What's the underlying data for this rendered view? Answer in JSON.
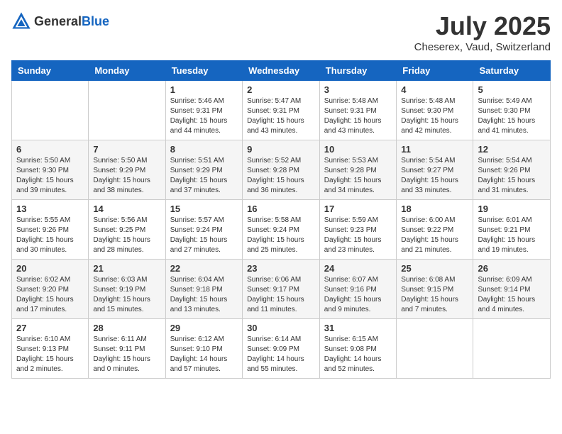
{
  "header": {
    "logo_general": "General",
    "logo_blue": "Blue",
    "month_title": "July 2025",
    "subtitle": "Cheserex, Vaud, Switzerland"
  },
  "days_of_week": [
    "Sunday",
    "Monday",
    "Tuesday",
    "Wednesday",
    "Thursday",
    "Friday",
    "Saturday"
  ],
  "weeks": [
    [
      {
        "day": "",
        "info": ""
      },
      {
        "day": "",
        "info": ""
      },
      {
        "day": "1",
        "info": "Sunrise: 5:46 AM\nSunset: 9:31 PM\nDaylight: 15 hours and 44 minutes."
      },
      {
        "day": "2",
        "info": "Sunrise: 5:47 AM\nSunset: 9:31 PM\nDaylight: 15 hours and 43 minutes."
      },
      {
        "day": "3",
        "info": "Sunrise: 5:48 AM\nSunset: 9:31 PM\nDaylight: 15 hours and 43 minutes."
      },
      {
        "day": "4",
        "info": "Sunrise: 5:48 AM\nSunset: 9:30 PM\nDaylight: 15 hours and 42 minutes."
      },
      {
        "day": "5",
        "info": "Sunrise: 5:49 AM\nSunset: 9:30 PM\nDaylight: 15 hours and 41 minutes."
      }
    ],
    [
      {
        "day": "6",
        "info": "Sunrise: 5:50 AM\nSunset: 9:30 PM\nDaylight: 15 hours and 39 minutes."
      },
      {
        "day": "7",
        "info": "Sunrise: 5:50 AM\nSunset: 9:29 PM\nDaylight: 15 hours and 38 minutes."
      },
      {
        "day": "8",
        "info": "Sunrise: 5:51 AM\nSunset: 9:29 PM\nDaylight: 15 hours and 37 minutes."
      },
      {
        "day": "9",
        "info": "Sunrise: 5:52 AM\nSunset: 9:28 PM\nDaylight: 15 hours and 36 minutes."
      },
      {
        "day": "10",
        "info": "Sunrise: 5:53 AM\nSunset: 9:28 PM\nDaylight: 15 hours and 34 minutes."
      },
      {
        "day": "11",
        "info": "Sunrise: 5:54 AM\nSunset: 9:27 PM\nDaylight: 15 hours and 33 minutes."
      },
      {
        "day": "12",
        "info": "Sunrise: 5:54 AM\nSunset: 9:26 PM\nDaylight: 15 hours and 31 minutes."
      }
    ],
    [
      {
        "day": "13",
        "info": "Sunrise: 5:55 AM\nSunset: 9:26 PM\nDaylight: 15 hours and 30 minutes."
      },
      {
        "day": "14",
        "info": "Sunrise: 5:56 AM\nSunset: 9:25 PM\nDaylight: 15 hours and 28 minutes."
      },
      {
        "day": "15",
        "info": "Sunrise: 5:57 AM\nSunset: 9:24 PM\nDaylight: 15 hours and 27 minutes."
      },
      {
        "day": "16",
        "info": "Sunrise: 5:58 AM\nSunset: 9:24 PM\nDaylight: 15 hours and 25 minutes."
      },
      {
        "day": "17",
        "info": "Sunrise: 5:59 AM\nSunset: 9:23 PM\nDaylight: 15 hours and 23 minutes."
      },
      {
        "day": "18",
        "info": "Sunrise: 6:00 AM\nSunset: 9:22 PM\nDaylight: 15 hours and 21 minutes."
      },
      {
        "day": "19",
        "info": "Sunrise: 6:01 AM\nSunset: 9:21 PM\nDaylight: 15 hours and 19 minutes."
      }
    ],
    [
      {
        "day": "20",
        "info": "Sunrise: 6:02 AM\nSunset: 9:20 PM\nDaylight: 15 hours and 17 minutes."
      },
      {
        "day": "21",
        "info": "Sunrise: 6:03 AM\nSunset: 9:19 PM\nDaylight: 15 hours and 15 minutes."
      },
      {
        "day": "22",
        "info": "Sunrise: 6:04 AM\nSunset: 9:18 PM\nDaylight: 15 hours and 13 minutes."
      },
      {
        "day": "23",
        "info": "Sunrise: 6:06 AM\nSunset: 9:17 PM\nDaylight: 15 hours and 11 minutes."
      },
      {
        "day": "24",
        "info": "Sunrise: 6:07 AM\nSunset: 9:16 PM\nDaylight: 15 hours and 9 minutes."
      },
      {
        "day": "25",
        "info": "Sunrise: 6:08 AM\nSunset: 9:15 PM\nDaylight: 15 hours and 7 minutes."
      },
      {
        "day": "26",
        "info": "Sunrise: 6:09 AM\nSunset: 9:14 PM\nDaylight: 15 hours and 4 minutes."
      }
    ],
    [
      {
        "day": "27",
        "info": "Sunrise: 6:10 AM\nSunset: 9:13 PM\nDaylight: 15 hours and 2 minutes."
      },
      {
        "day": "28",
        "info": "Sunrise: 6:11 AM\nSunset: 9:11 PM\nDaylight: 15 hours and 0 minutes."
      },
      {
        "day": "29",
        "info": "Sunrise: 6:12 AM\nSunset: 9:10 PM\nDaylight: 14 hours and 57 minutes."
      },
      {
        "day": "30",
        "info": "Sunrise: 6:14 AM\nSunset: 9:09 PM\nDaylight: 14 hours and 55 minutes."
      },
      {
        "day": "31",
        "info": "Sunrise: 6:15 AM\nSunset: 9:08 PM\nDaylight: 14 hours and 52 minutes."
      },
      {
        "day": "",
        "info": ""
      },
      {
        "day": "",
        "info": ""
      }
    ]
  ]
}
